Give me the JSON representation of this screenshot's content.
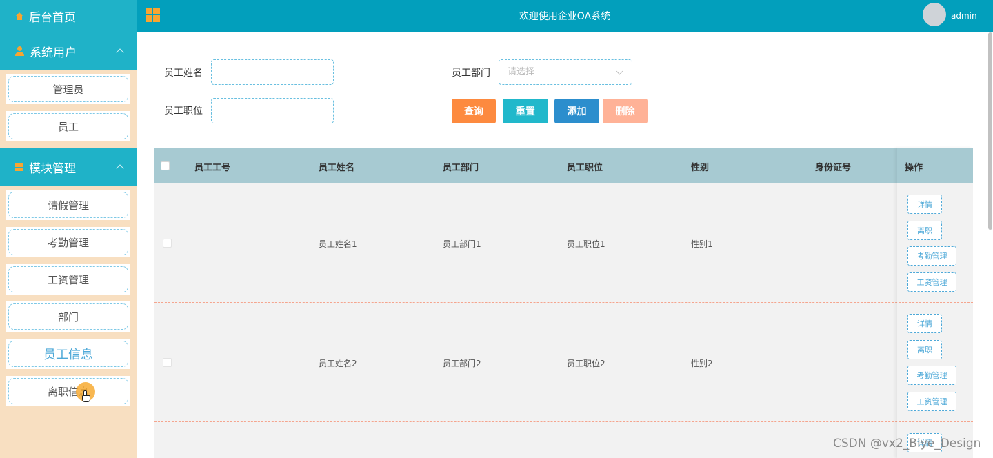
{
  "sidebar": {
    "home": "后台首页",
    "groups": [
      {
        "title": "系统用户",
        "items": [
          "管理员",
          "员工"
        ]
      },
      {
        "title": "模块管理",
        "items": [
          "请假管理",
          "考勤管理",
          "工资管理",
          "部门",
          "员工信息",
          "离职信息"
        ]
      }
    ],
    "active_item": "员工信息"
  },
  "topbar": {
    "title": "欢迎使用企业OA系统",
    "user": "admin"
  },
  "filters": {
    "name_label": "员工姓名",
    "dept_label": "员工部门",
    "dept_placeholder": "请选择",
    "position_label": "员工职位"
  },
  "buttons": {
    "query": "查询",
    "reset": "重置",
    "add": "添加",
    "delete": "删除"
  },
  "colors": {
    "topbar": "#029fbc",
    "sidebar_header": "#1fb2c8",
    "query": "#fd8a3f",
    "reset": "#21b8cb",
    "add": "#2c8ecd",
    "delete": "#ffb297"
  },
  "table": {
    "headers": [
      "员工工号",
      "员工姓名",
      "员工部门",
      "员工职位",
      "性别",
      "身份证号",
      "操作"
    ],
    "rows": [
      {
        "id": "",
        "name": "员工姓名1",
        "dept": "员工部门1",
        "position": "员工职位1",
        "gender": "性别1",
        "idcard": ""
      },
      {
        "id": "",
        "name": "员工姓名2",
        "dept": "员工部门2",
        "position": "员工职位2",
        "gender": "性别2",
        "idcard": ""
      }
    ],
    "row_actions": [
      "详情",
      "离职",
      "考勤管理",
      "工资管理"
    ]
  },
  "watermark": "CSDN @vx2_Biye_Design"
}
